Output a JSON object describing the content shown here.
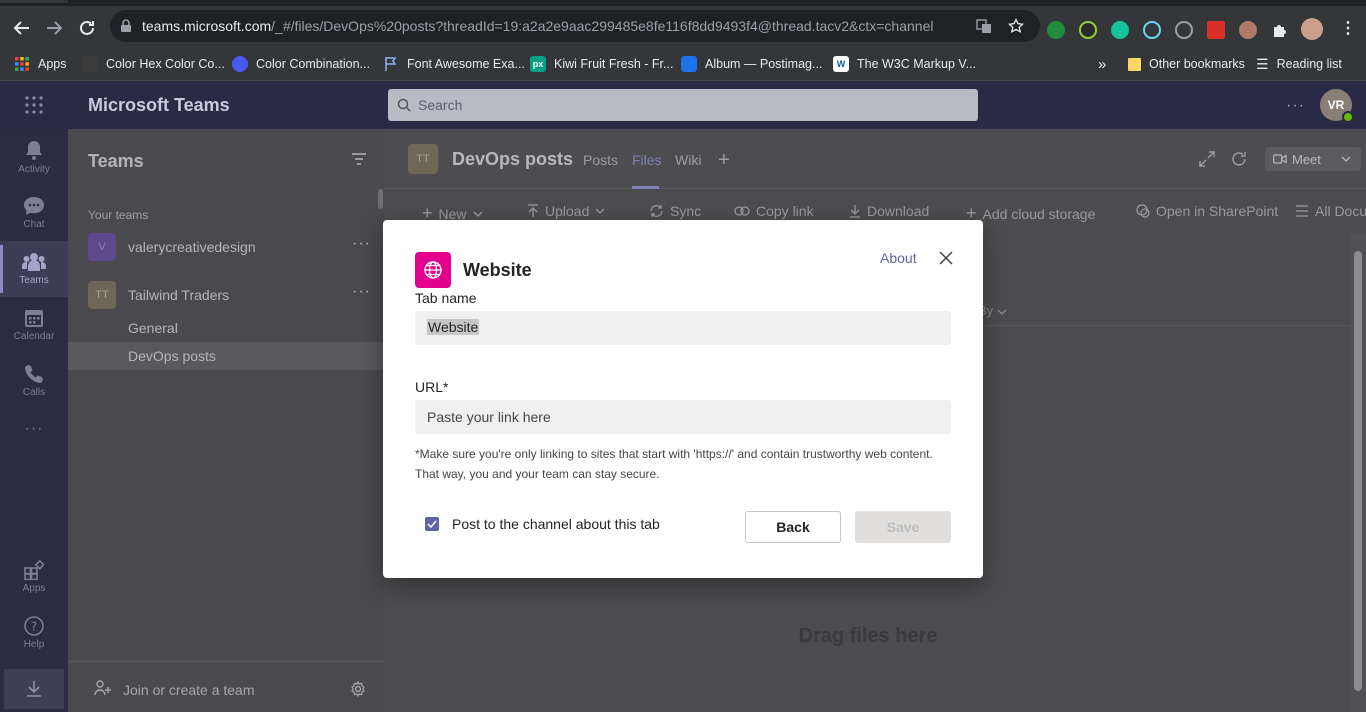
{
  "browser": {
    "url_host": "teams.microsoft.com",
    "url_rest": "/_#/files/DevOps%20posts?threadId=19:a2a2e9aac299485e8fe116f8dd9493f4@thread.tacv2&ctx=channel",
    "bookmarks": [
      {
        "label": "Apps",
        "icon": "apps-grid-icon",
        "color": "#ea4335"
      },
      {
        "label": "Color Hex Color Co...",
        "icon": "colorhex-icon",
        "color": "#3c3c3c"
      },
      {
        "label": "Color Combination...",
        "icon": "colorcombo-icon",
        "color": "#4a5af0"
      },
      {
        "label": "Font Awesome Exa...",
        "icon": "flag-icon",
        "color": "#8ab4f8"
      },
      {
        "label": "Kiwi Fruit Fresh - Fr...",
        "icon": "px-icon",
        "color": "#05a081"
      },
      {
        "label": "Album — Postimag...",
        "icon": "postimage-icon",
        "color": "#1a73e8"
      },
      {
        "label": "The W3C Markup V...",
        "icon": "w3c-icon",
        "color": "#ffffff"
      }
    ],
    "overflow": "»",
    "other_bookmarks": "Other bookmarks",
    "reading_list": "Reading list"
  },
  "header": {
    "app_title": "Microsoft Teams",
    "search_placeholder": "Search",
    "more": "···",
    "avatar_initials": "VR"
  },
  "rail": [
    {
      "label": "Activity",
      "icon": "bell-icon"
    },
    {
      "label": "Chat",
      "icon": "chat-icon"
    },
    {
      "label": "Teams",
      "icon": "teams-icon",
      "active": true
    },
    {
      "label": "Calendar",
      "icon": "calendar-icon"
    },
    {
      "label": "Calls",
      "icon": "phone-icon"
    },
    {
      "label": "···",
      "icon": "more-icon"
    },
    {
      "label": "Apps",
      "icon": "apps-icon"
    },
    {
      "label": "Help",
      "icon": "help-icon"
    }
  ],
  "panel": {
    "title": "Teams",
    "section_label": "Your teams",
    "teams": [
      {
        "initials": "V",
        "name": "valerycreativedesign",
        "more": "···"
      },
      {
        "initials": "TT",
        "name": "Tailwind Traders",
        "more": "···"
      }
    ],
    "channels": [
      "General",
      "DevOps posts"
    ],
    "footer": "Join or create a team"
  },
  "channel": {
    "initials": "TT",
    "name": "DevOps posts",
    "tabs": [
      "Posts",
      "Files",
      "Wiki"
    ],
    "active_tab": "Files",
    "meet_label": "Meet",
    "toolbar": [
      "New",
      "Upload",
      "Sync",
      "Copy link",
      "Download",
      "Add cloud storage",
      "Open in SharePoint",
      "All Docu"
    ],
    "column_partial": "By",
    "drag_text": "Drag files here"
  },
  "modal": {
    "title": "Website",
    "about": "About",
    "tab_name_label": "Tab name",
    "tab_name_value": "Website",
    "url_label": "URL*",
    "url_placeholder": "Paste your link here",
    "hint": "*Make sure you're only linking to sites that start with 'https://' and contain trustworthy web content. That way, you and your team can stay secure.",
    "checkbox_label": "Post to the channel about this tab",
    "checkbox_checked": true,
    "back_label": "Back",
    "save_label": "Save",
    "accent_color": "#6264a7",
    "icon_color": "#e3008c"
  }
}
